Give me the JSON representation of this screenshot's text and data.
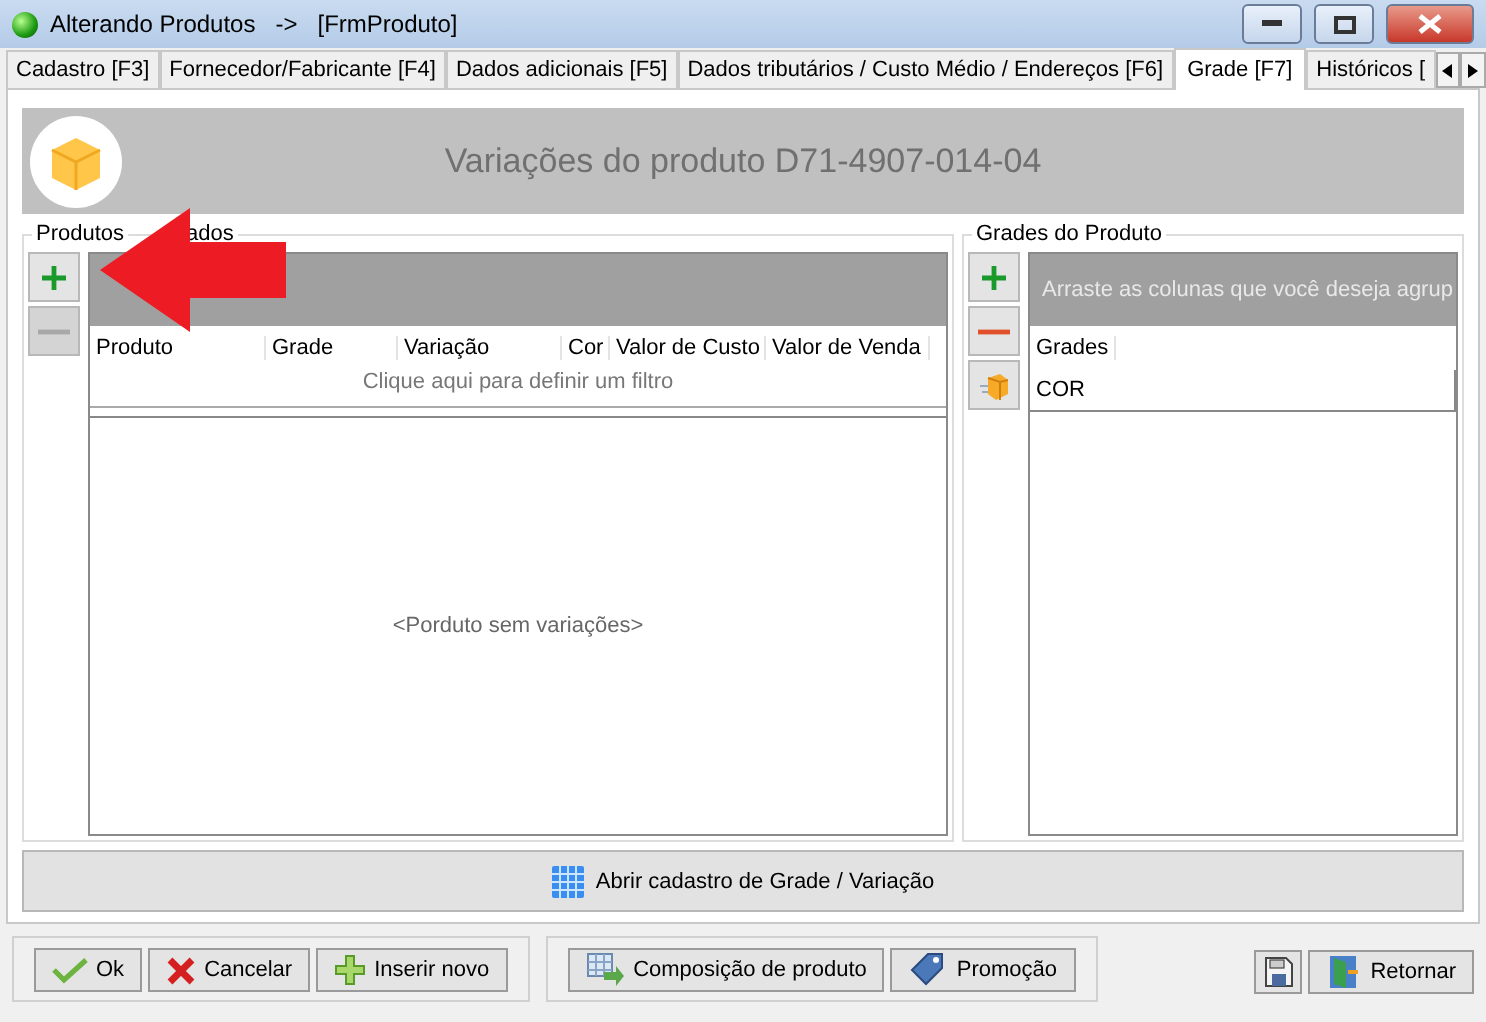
{
  "window": {
    "title": "Alterando Produtos   ->   [FrmProduto]"
  },
  "tabs": [
    {
      "label": "Cadastro [F3]",
      "selected": false
    },
    {
      "label": "Fornecedor/Fabricante [F4]",
      "selected": false
    },
    {
      "label": "Dados adicionais [F5]",
      "selected": false
    },
    {
      "label": "Dados tributários / Custo Médio / Endereços [F6]",
      "selected": false
    },
    {
      "label": "Grade [F7]",
      "selected": true
    },
    {
      "label": "Históricos [",
      "selected": false
    }
  ],
  "header": {
    "title": "Variações do produto D71-4907-014-04"
  },
  "linked_products": {
    "label_parts": [
      "Produtos",
      "ados"
    ],
    "buttons": [
      {
        "kind": "add",
        "disabled": false
      },
      {
        "kind": "remove",
        "disabled": true
      }
    ],
    "columns": [
      "Produto",
      "Grade",
      "Variação",
      "Cor",
      "Valor de Custo",
      "Valor de Venda"
    ],
    "filter_hint": "Clique aqui para definir um filtro",
    "empty_message": "<Porduto sem variações>"
  },
  "product_grades": {
    "label": "Grades do Produto",
    "buttons": [
      {
        "kind": "add",
        "disabled": false
      },
      {
        "kind": "remove",
        "disabled": false
      },
      {
        "kind": "box",
        "disabled": false
      }
    ],
    "group_hint": "Arraste as colunas que você deseja agrup",
    "column": "Grades",
    "rows": [
      "COR"
    ]
  },
  "open_button": {
    "label": "Abrir cadastro de Grade / Variação"
  },
  "footer": [
    [
      {
        "kind": "ok",
        "label": "Ok"
      },
      {
        "kind": "cancel",
        "label": "Cancelar"
      },
      {
        "kind": "new",
        "label": "Inserir novo"
      }
    ],
    [
      {
        "kind": "composition",
        "label": "Composição de produto"
      },
      {
        "kind": "promo",
        "label": "Promoção"
      }
    ],
    [
      {
        "kind": "save"
      },
      {
        "kind": "back",
        "label": "Retornar"
      }
    ]
  ]
}
